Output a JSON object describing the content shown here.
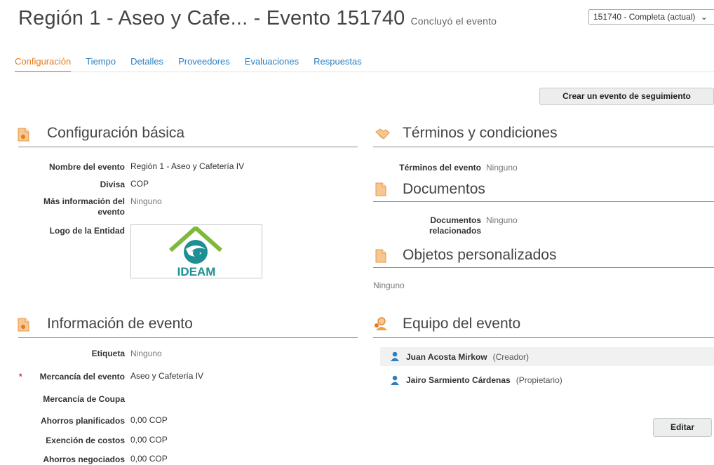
{
  "header": {
    "title": "Región 1 - Aseo y Cafe... - Evento 151740",
    "status": "Concluyó el evento",
    "version_select": "151740 - Completa (actual)"
  },
  "tabs": [
    {
      "label": "Configuración"
    },
    {
      "label": "Tiempo"
    },
    {
      "label": "Detalles"
    },
    {
      "label": "Proveedores"
    },
    {
      "label": "Evaluaciones"
    },
    {
      "label": "Respuestas"
    }
  ],
  "actions": {
    "follow_up": "Crear un evento de seguimiento",
    "edit": "Editar"
  },
  "basic": {
    "title": "Configuración básica",
    "name_label": "Nombre del evento",
    "name_value": "Región 1 - Aseo y Cafetería IV",
    "currency_label": "Divisa",
    "currency_value": "COP",
    "more_label": "Más información del evento",
    "more_value": "Ninguno",
    "logo_label": "Logo de la Entidad",
    "logo_text": "IDEAM"
  },
  "info": {
    "title": "Información de evento",
    "required_mark": "*",
    "tag_label": "Etiqueta",
    "tag_value": "Ninguno",
    "commodity_label": "Mercancía del evento",
    "commodity_value": "Aseo y Cafetería IV",
    "coupa_label": "Mercancía de Coupa",
    "planned_label": "Ahorros planificados",
    "planned_value": "0,00 COP",
    "exemption_label": "Exención de costos",
    "exemption_value": "0,00 COP",
    "negotiated_label": "Ahorros negociados",
    "negotiated_value": "0,00 COP"
  },
  "terms": {
    "title": "Términos y condiciones",
    "label": "Términos del evento",
    "value": "Ninguno"
  },
  "documents": {
    "title": "Documentos",
    "label": "Documentos relacionados",
    "value": "Ninguno"
  },
  "custom": {
    "title": "Objetos personalizados",
    "value": "Ninguno"
  },
  "team": {
    "title": "Equipo del evento",
    "members": [
      {
        "name": "Juan Acosta Mirkow",
        "role": "(Creador)"
      },
      {
        "name": "Jairo Sarmiento Cárdenas",
        "role": "(Propietario)"
      }
    ]
  },
  "colors": {
    "tab_link": "#2a7fc2",
    "tab_active": "#e8791c",
    "logo_teal": "#1e8f93",
    "logo_green": "#7fb93a",
    "icon_orange": "#f0a24a",
    "person_blue": "#2a7fc2"
  }
}
